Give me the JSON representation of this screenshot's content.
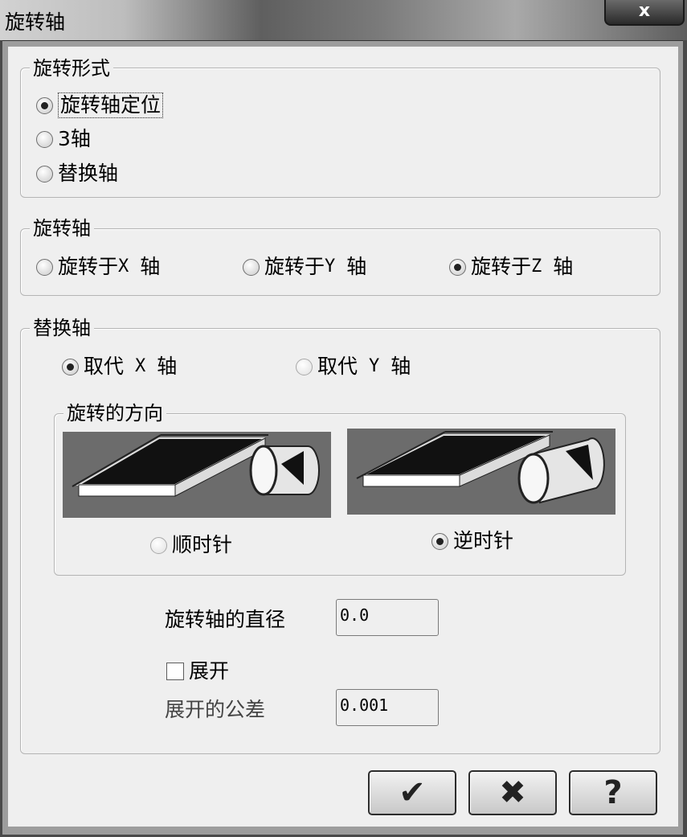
{
  "window": {
    "title": "旋转轴",
    "close_glyph": "x"
  },
  "rotation_form": {
    "legend": "旋转形式",
    "options": [
      {
        "label": "旋转轴定位",
        "selected": true
      },
      {
        "label": "3轴",
        "selected": false
      },
      {
        "label": "替换轴",
        "selected": false
      }
    ]
  },
  "rotation_axis": {
    "legend": "旋转轴",
    "options": [
      {
        "prefix": "旋转于",
        "axis": "X",
        "suffix": "轴",
        "selected": false
      },
      {
        "prefix": "旋转于",
        "axis": "Y",
        "suffix": "轴",
        "selected": false
      },
      {
        "prefix": "旋转于",
        "axis": "Z",
        "suffix": "轴",
        "selected": true
      }
    ]
  },
  "replace_axis": {
    "legend": "替换轴",
    "options": [
      {
        "prefix": "取代",
        "axis": "X",
        "suffix": "轴",
        "selected": true
      },
      {
        "prefix": "取代",
        "axis": "Y",
        "suffix": "轴",
        "selected": false
      }
    ],
    "direction": {
      "legend": "旋转的方向",
      "options": [
        {
          "label": "顺时针",
          "selected": false
        },
        {
          "label": "逆时针",
          "selected": true
        }
      ]
    }
  },
  "diameter": {
    "label": "旋转轴的直径",
    "value": "0.0"
  },
  "unroll": {
    "label": "展开",
    "checked": false
  },
  "tolerance": {
    "label": "展开的公差",
    "value": "0.001"
  },
  "buttons": {
    "ok": "✔",
    "cancel": "✖",
    "help": "?"
  }
}
